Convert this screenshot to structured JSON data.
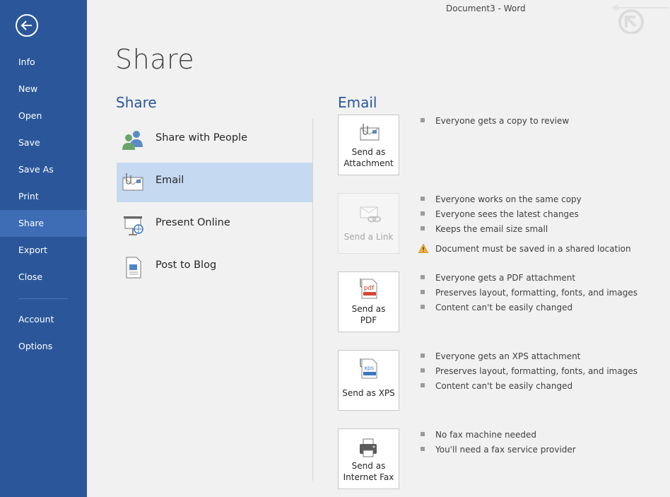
{
  "window_title": "Document3 - Word",
  "sidebar": {
    "items": [
      {
        "label": "Info"
      },
      {
        "label": "New"
      },
      {
        "label": "Open"
      },
      {
        "label": "Save"
      },
      {
        "label": "Save As"
      },
      {
        "label": "Print"
      },
      {
        "label": "Share"
      },
      {
        "label": "Export"
      },
      {
        "label": "Close"
      },
      {
        "label": "Account"
      },
      {
        "label": "Options"
      }
    ],
    "active": "Share",
    "bg_color": "#2b579a",
    "active_color": "#3e6db5"
  },
  "page_title": "Share",
  "share_section": {
    "heading": "Share",
    "options": [
      {
        "label": "Share with People",
        "icon": "people-icon"
      },
      {
        "label": "Email",
        "icon": "email-icon",
        "selected": true
      },
      {
        "label": "Present Online",
        "icon": "present-online-icon"
      },
      {
        "label": "Post to Blog",
        "icon": "blog-icon"
      }
    ]
  },
  "email_section": {
    "heading": "Email",
    "actions": [
      {
        "label_line1": "Send as",
        "label_line2": "Attachment",
        "icon": "attachment-icon",
        "bullets": [
          "Everyone gets a copy to review"
        ]
      },
      {
        "label_line1": "Send a Link",
        "label_line2": "",
        "icon": "link-icon",
        "disabled": true,
        "bullets": [
          "Everyone works on the same copy",
          "Everyone sees the latest changes",
          "Keeps the email size small"
        ],
        "warning": "Document must be saved in a shared location"
      },
      {
        "label_line1": "Send as",
        "label_line2": "PDF",
        "icon": "pdf-icon",
        "bullets": [
          "Everyone gets a PDF attachment",
          "Preserves layout, formatting, fonts, and images",
          "Content can't be easily changed"
        ]
      },
      {
        "label_line1": "Send as XPS",
        "label_line2": "",
        "icon": "xps-icon",
        "bullets": [
          "Everyone gets an XPS attachment",
          "Preserves layout, formatting, fonts, and images",
          "Content can't be easily changed"
        ]
      },
      {
        "label_line1": "Send as",
        "label_line2": "Internet Fax",
        "icon": "fax-icon",
        "bullets": [
          "No fax machine needed",
          "You'll need a fax service provider"
        ]
      }
    ]
  },
  "accent_color": "#2b579a"
}
